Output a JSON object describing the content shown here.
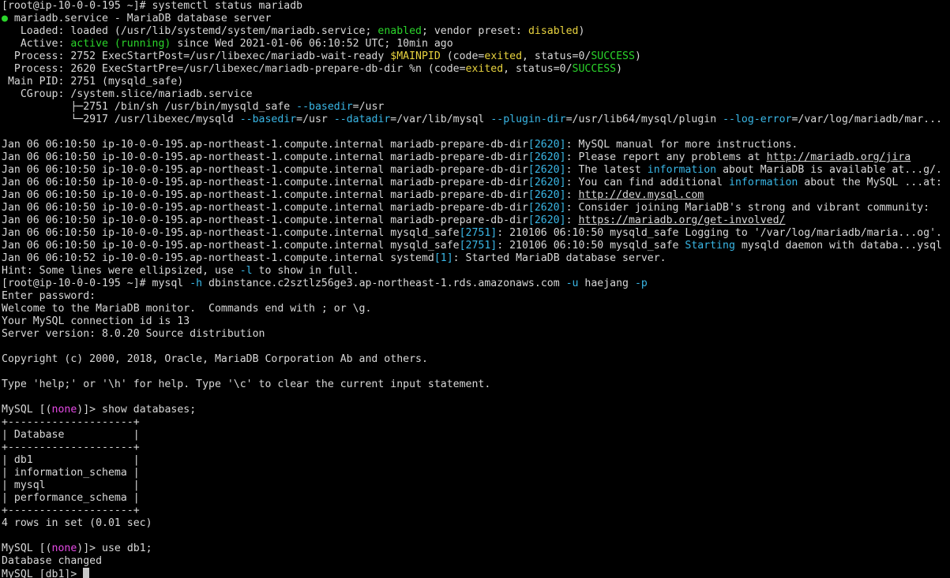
{
  "window": {
    "title": ""
  },
  "colors": {
    "default": "#d8d8d8",
    "green": "#2bd52b",
    "yellow": "#e8d33f",
    "cyan": "#3ab7e6",
    "magenta": "#e64ae6",
    "background": "#000000",
    "cursor": "#c8c8c8"
  },
  "terminal": {
    "lines": [
      [
        {
          "t": "[root@ip-10-0-0-195 ~]# systemctl status mariadb"
        }
      ],
      [
        {
          "t": "●",
          "c": "green"
        },
        {
          "t": " mariadb.service - MariaDB database server"
        }
      ],
      [
        {
          "t": "   Loaded: loaded (/usr/lib/systemd/system/mariadb.service; "
        },
        {
          "t": "enabled",
          "c": "green"
        },
        {
          "t": "; vendor preset: "
        },
        {
          "t": "disabled",
          "c": "yellow"
        },
        {
          "t": ")"
        }
      ],
      [
        {
          "t": "   Active: "
        },
        {
          "t": "active (running)",
          "c": "green"
        },
        {
          "t": " since Wed 2021-01-06 06:10:52 UTC; 10min ago"
        }
      ],
      [
        {
          "t": "  Process: 2752 ExecStartPost=/usr/libexec/mariadb-wait-ready "
        },
        {
          "t": "$MAINPID",
          "c": "yellow"
        },
        {
          "t": " (code="
        },
        {
          "t": "exited",
          "c": "yellow"
        },
        {
          "t": ", status=0/"
        },
        {
          "t": "SUCCESS",
          "c": "green"
        },
        {
          "t": ")"
        }
      ],
      [
        {
          "t": "  Process: 2620 ExecStartPre=/usr/libexec/mariadb-prepare-db-dir %n (code="
        },
        {
          "t": "exited",
          "c": "yellow"
        },
        {
          "t": ", status=0/"
        },
        {
          "t": "SUCCESS",
          "c": "green"
        },
        {
          "t": ")"
        }
      ],
      [
        {
          "t": " Main PID: 2751 (mysqld_safe)"
        }
      ],
      [
        {
          "t": "   CGroup: /system.slice/mariadb.service"
        }
      ],
      [
        {
          "t": "           ├─2751 /bin/sh /usr/bin/mysqld_safe "
        },
        {
          "t": "--basedir",
          "c": "cyan"
        },
        {
          "t": "=/usr"
        }
      ],
      [
        {
          "t": "           └─2917 /usr/libexec/mysqld "
        },
        {
          "t": "--basedir",
          "c": "cyan"
        },
        {
          "t": "=/usr "
        },
        {
          "t": "--datadir",
          "c": "cyan"
        },
        {
          "t": "=/var/lib/mysql "
        },
        {
          "t": "--plugin-dir",
          "c": "cyan"
        },
        {
          "t": "=/usr/lib64/mysql/plugin "
        },
        {
          "t": "--log-error",
          "c": "cyan"
        },
        {
          "t": "=/var/log/mariadb/mar..."
        }
      ],
      [
        {
          "t": ""
        }
      ],
      [
        {
          "t": "Jan 06 06:10:50 ip-10-0-0-195.ap-northeast-1.compute.internal mariadb-prepare-db-dir"
        },
        {
          "t": "[2620]",
          "c": "cyan"
        },
        {
          "t": ": MySQL manual for more instructions."
        }
      ],
      [
        {
          "t": "Jan 06 06:10:50 ip-10-0-0-195.ap-northeast-1.compute.internal mariadb-prepare-db-dir"
        },
        {
          "t": "[2620]",
          "c": "cyan"
        },
        {
          "t": ": Please report any problems at "
        },
        {
          "t": "http://mariadb.org/jira",
          "u": true
        }
      ],
      [
        {
          "t": "Jan 06 06:10:50 ip-10-0-0-195.ap-northeast-1.compute.internal mariadb-prepare-db-dir"
        },
        {
          "t": "[2620]",
          "c": "cyan"
        },
        {
          "t": ": The latest "
        },
        {
          "t": "information",
          "c": "cyan"
        },
        {
          "t": " about MariaDB is available at...g/."
        }
      ],
      [
        {
          "t": "Jan 06 06:10:50 ip-10-0-0-195.ap-northeast-1.compute.internal mariadb-prepare-db-dir"
        },
        {
          "t": "[2620]",
          "c": "cyan"
        },
        {
          "t": ": You can find additional "
        },
        {
          "t": "information",
          "c": "cyan"
        },
        {
          "t": " about the MySQL ...at:"
        }
      ],
      [
        {
          "t": "Jan 06 06:10:50 ip-10-0-0-195.ap-northeast-1.compute.internal mariadb-prepare-db-dir"
        },
        {
          "t": "[2620]",
          "c": "cyan"
        },
        {
          "t": ": "
        },
        {
          "t": "http://dev.mysql.com",
          "u": true
        }
      ],
      [
        {
          "t": "Jan 06 06:10:50 ip-10-0-0-195.ap-northeast-1.compute.internal mariadb-prepare-db-dir"
        },
        {
          "t": "[2620]",
          "c": "cyan"
        },
        {
          "t": ": Consider joining MariaDB's strong and vibrant community:"
        }
      ],
      [
        {
          "t": "Jan 06 06:10:50 ip-10-0-0-195.ap-northeast-1.compute.internal mariadb-prepare-db-dir"
        },
        {
          "t": "[2620]",
          "c": "cyan"
        },
        {
          "t": ": "
        },
        {
          "t": "https://mariadb.org/get-involved/",
          "u": true
        }
      ],
      [
        {
          "t": "Jan 06 06:10:50 ip-10-0-0-195.ap-northeast-1.compute.internal mysqld_safe"
        },
        {
          "t": "[2751]",
          "c": "cyan"
        },
        {
          "t": ": 210106 06:10:50 mysqld_safe Logging to '/var/log/mariadb/maria...og'."
        }
      ],
      [
        {
          "t": "Jan 06 06:10:50 ip-10-0-0-195.ap-northeast-1.compute.internal mysqld_safe"
        },
        {
          "t": "[2751]",
          "c": "cyan"
        },
        {
          "t": ": 210106 06:10:50 mysqld_safe "
        },
        {
          "t": "Starting",
          "c": "cyan"
        },
        {
          "t": " mysqld daemon with databa...ysql"
        }
      ],
      [
        {
          "t": "Jan 06 06:10:52 ip-10-0-0-195.ap-northeast-1.compute.internal systemd"
        },
        {
          "t": "[1]",
          "c": "cyan"
        },
        {
          "t": ": Started MariaDB database server."
        }
      ],
      [
        {
          "t": "Hint: Some lines were ellipsized, use "
        },
        {
          "t": "-l",
          "c": "cyan"
        },
        {
          "t": " to show in full."
        }
      ],
      [
        {
          "t": "[root@ip-10-0-0-195 ~]# mysql "
        },
        {
          "t": "-h",
          "c": "cyan"
        },
        {
          "t": " dbinstance.c2sztlz56ge3.ap-northeast-1.rds.amazonaws.com "
        },
        {
          "t": "-u",
          "c": "cyan"
        },
        {
          "t": " haejang "
        },
        {
          "t": "-p",
          "c": "cyan"
        }
      ],
      [
        {
          "t": "Enter password:"
        }
      ],
      [
        {
          "t": "Welcome to the MariaDB monitor.  Commands end with ; or \\g."
        }
      ],
      [
        {
          "t": "Your MySQL connection id is 13"
        }
      ],
      [
        {
          "t": "Server version: 8.0.20 Source distribution"
        }
      ],
      [
        {
          "t": ""
        }
      ],
      [
        {
          "t": "Copyright (c) 2000, 2018, Oracle, MariaDB Corporation Ab and others."
        }
      ],
      [
        {
          "t": ""
        }
      ],
      [
        {
          "t": "Type 'help;' or '\\h' for help. Type '\\c' to clear the current input statement."
        }
      ],
      [
        {
          "t": ""
        }
      ],
      [
        {
          "t": "MySQL [("
        },
        {
          "t": "none",
          "c": "magenta"
        },
        {
          "t": ")]> show databases;"
        }
      ],
      [
        {
          "t": "+--------------------+"
        }
      ],
      [
        {
          "t": "| Database           |"
        }
      ],
      [
        {
          "t": "+--------------------+"
        }
      ],
      [
        {
          "t": "| db1                |"
        }
      ],
      [
        {
          "t": "| information_schema |"
        }
      ],
      [
        {
          "t": "| mysql              |"
        }
      ],
      [
        {
          "t": "| performance_schema |"
        }
      ],
      [
        {
          "t": "+--------------------+"
        }
      ],
      [
        {
          "t": "4 rows in set (0.01 sec)"
        }
      ],
      [
        {
          "t": ""
        }
      ],
      [
        {
          "t": "MySQL [("
        },
        {
          "t": "none",
          "c": "magenta"
        },
        {
          "t": ")]> use db1;"
        }
      ],
      [
        {
          "t": "Database changed"
        }
      ],
      [
        {
          "t": "MySQL [db1]> "
        }
      ]
    ]
  }
}
